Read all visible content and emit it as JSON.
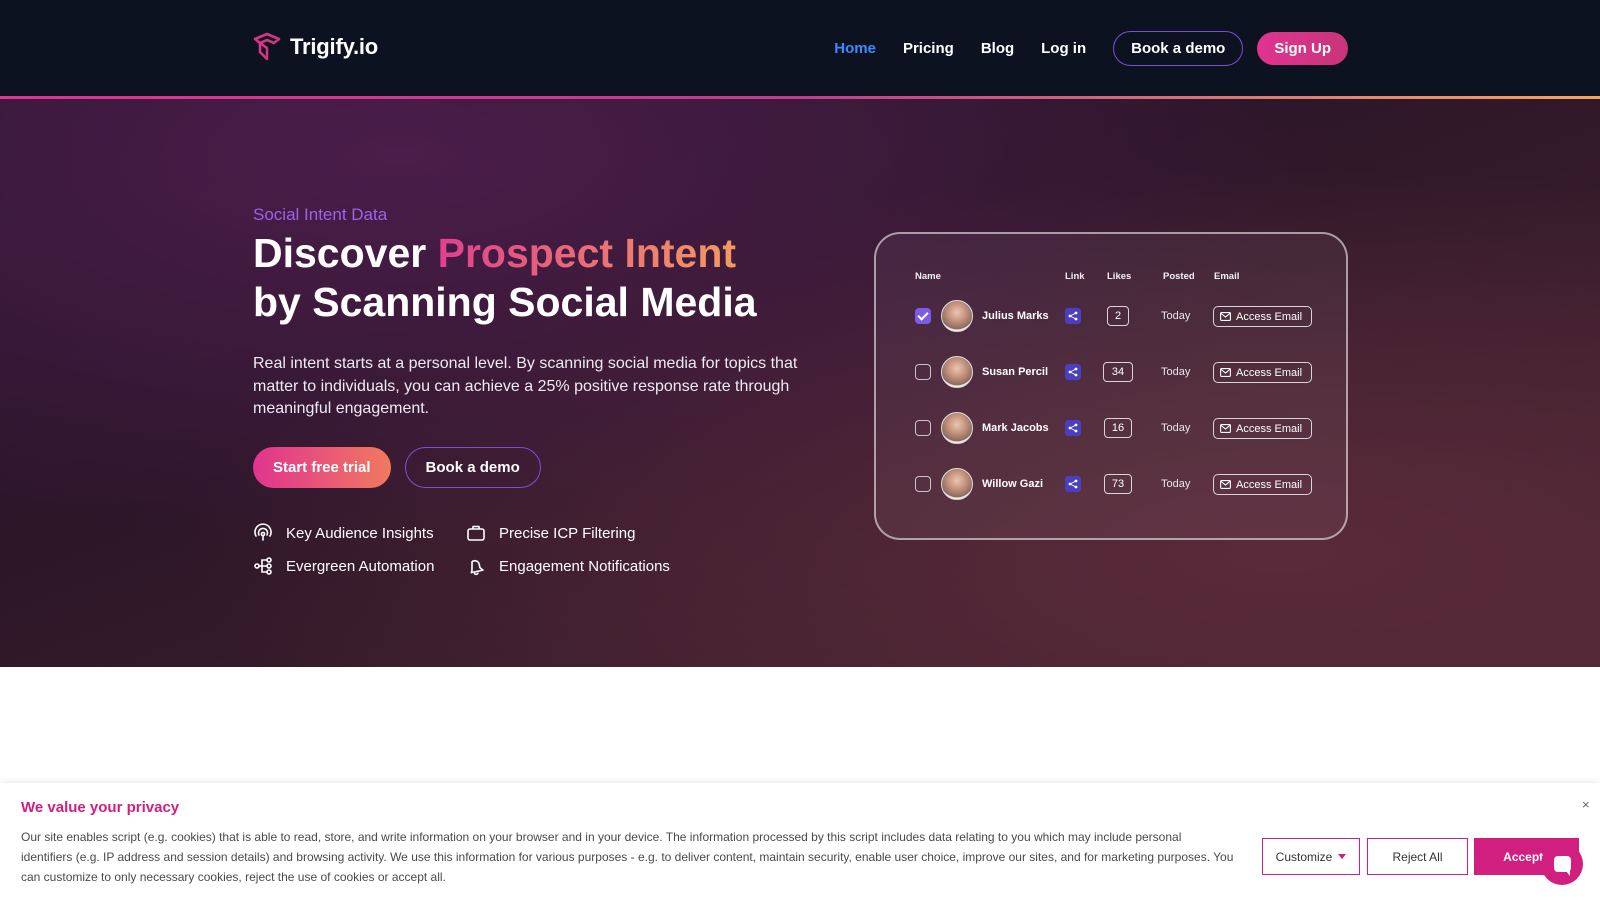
{
  "nav": {
    "brand": "Trigify.io",
    "links": [
      "Home",
      "Pricing",
      "Blog",
      "Log in"
    ],
    "active": "Home",
    "book_demo": "Book a demo",
    "signup": "Sign Up"
  },
  "hero": {
    "eyebrow": "Social Intent Data",
    "title_pre": "Discover ",
    "title_highlight": "Prospect Intent",
    "title_post": "by Scanning Social Media",
    "lead": "Real intent starts at a personal level. By scanning social media for topics that matter to individuals, you can achieve a 25% positive response rate through meaningful engagement.",
    "cta_primary": "Start free trial",
    "cta_secondary": "Book a demo",
    "features": [
      {
        "label": "Key Audience Insights",
        "icon": "audience-signal-icon"
      },
      {
        "label": "Precise ICP Filtering",
        "icon": "briefcase-icon"
      },
      {
        "label": "Evergreen Automation",
        "icon": "workflow-icon"
      },
      {
        "label": "Engagement Notifications",
        "icon": "bell-icon"
      }
    ]
  },
  "table": {
    "columns": [
      "Name",
      "Link",
      "Likes",
      "Posted",
      "Email"
    ],
    "rows": [
      {
        "name": "Julius Marks",
        "likes": "2",
        "posted": "Today",
        "email": "Access Email",
        "checked": true
      },
      {
        "name": "Susan Percil",
        "likes": "34",
        "posted": "Today",
        "email": "Access Email",
        "checked": false
      },
      {
        "name": "Mark Jacobs",
        "likes": "16",
        "posted": "Today",
        "email": "Access Email",
        "checked": false
      },
      {
        "name": "Willow Gazi",
        "likes": "73",
        "posted": "Today",
        "email": "Access Email",
        "checked": false
      }
    ]
  },
  "cookie": {
    "title": "We value your privacy",
    "text": "Our site enables script (e.g. cookies) that is able to read, store, and write information on your browser and in your device. The information processed by this script includes data relating to you which may include personal identifiers (e.g. IP address and session details) and browsing activity. We use this information for various purposes - e.g. to deliver content, maintain security, enable user choice, improve our sites, and for marketing purposes. You can customize to only necessary cookies, reject the use of cookies or accept all.",
    "customize": "Customize",
    "reject": "Reject All",
    "accept": "Accept /",
    "close": "×"
  },
  "colors": {
    "nav_bg": "#0d1220",
    "accent_pink": "#d01f7f",
    "accent_purple": "#7a4fd6",
    "active_link": "#3d8bff"
  }
}
